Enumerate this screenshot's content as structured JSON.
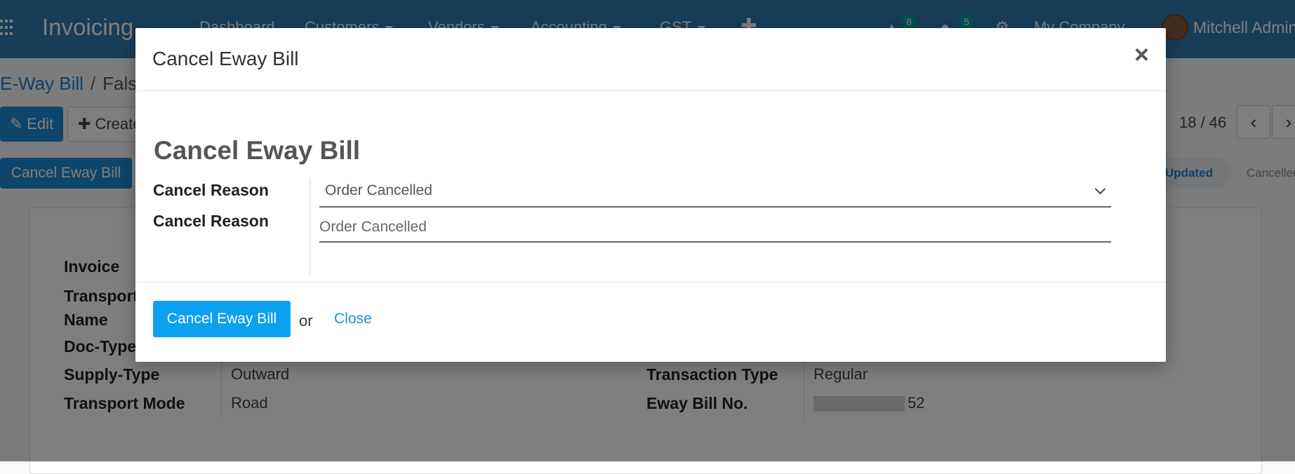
{
  "navbar": {
    "brand": "Invoicing",
    "menus": [
      {
        "label": "Dashboard",
        "has_caret": false
      },
      {
        "label": "Customers",
        "has_caret": true
      },
      {
        "label": "Vendors",
        "has_caret": true
      },
      {
        "label": "Accounting",
        "has_caret": true
      },
      {
        "label": "GST",
        "has_caret": true
      }
    ],
    "plus_icon": "plus-icon",
    "activity_count": "8",
    "messages_count": "5",
    "company": "My Company",
    "user": "Mitchell Admin"
  },
  "breadcrumb": {
    "parent": "E-Way Bill",
    "separator": "/",
    "current": "False"
  },
  "toolbar": {
    "edit_label": "Edit",
    "create_label": "Create",
    "pager": "18 / 46"
  },
  "header_button": "Cancel Eway Bill",
  "statusbar": {
    "active": "Updated",
    "next": "Cancelled"
  },
  "form": {
    "left": {
      "invoice_label": "Invoice",
      "transporter_label_1": "Transporter",
      "transporter_label_2": "Name",
      "doc_type_label": "Doc-Type",
      "supply_type_label": "Supply-Type",
      "supply_type_value": "Outward",
      "transport_mode_label": "Transport Mode",
      "transport_mode_value": "Road"
    },
    "right": {
      "transaction_type_label": "Transaction Type",
      "transaction_type_value": "Regular",
      "eway_bill_no_label": "Eway Bill No.",
      "eway_bill_no_suffix": "52"
    }
  },
  "modal": {
    "title": "Cancel Eway Bill",
    "close_symbol": "×",
    "heading": "Cancel Eway Bill",
    "cancel_reason_select_label": "Cancel Reason",
    "cancel_reason_select_value": "Order Cancelled",
    "cancel_reason_text_label": "Cancel Reason",
    "cancel_reason_text_value": "Order Cancelled",
    "primary_button": "Cancel Eway Bill",
    "or_text": "or",
    "close_link": "Close"
  },
  "colors": {
    "navbar": "#2f7bb0",
    "primary_button": "#0ba1f0",
    "link": "#1f8fd8",
    "badge": "#00a09d"
  }
}
